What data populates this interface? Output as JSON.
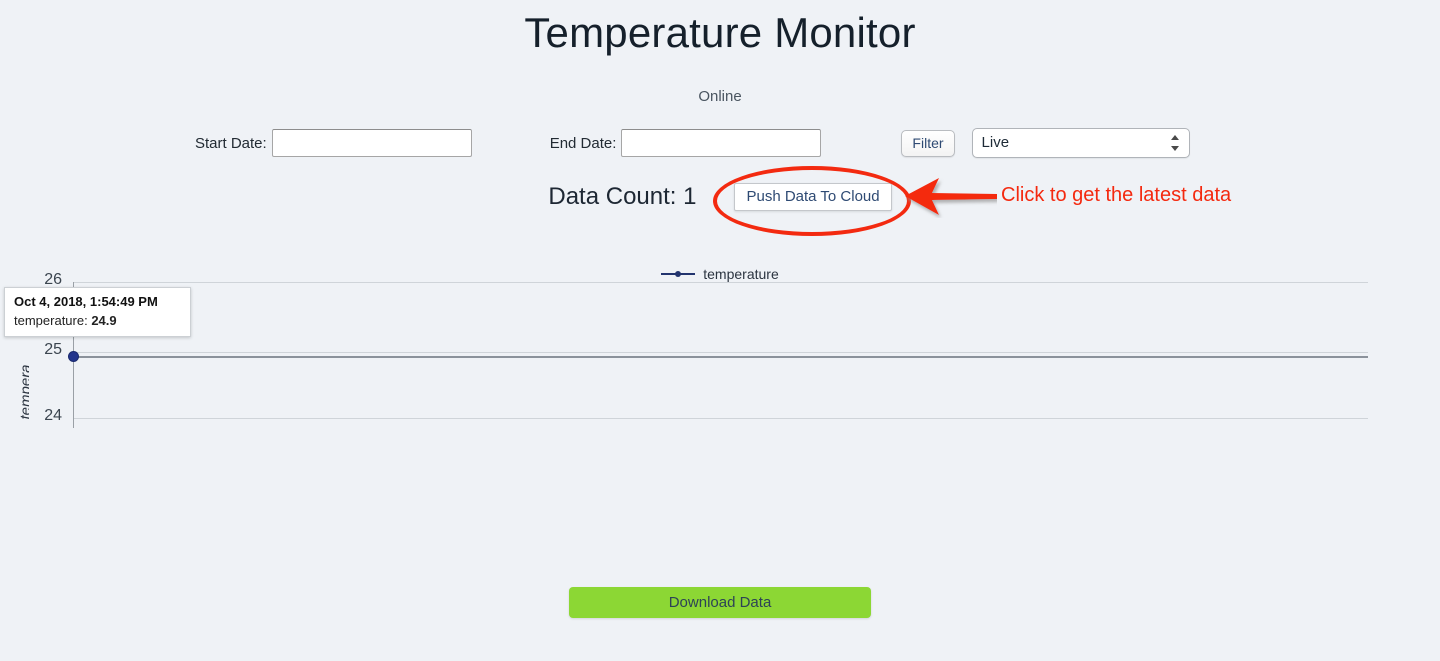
{
  "header": {
    "title": "Temperature Monitor",
    "status": "Online"
  },
  "filters": {
    "start_date_label": "Start Date:",
    "start_date_value": "",
    "start_date_placeholder": "",
    "end_date_label": "End Date:",
    "end_date_value": "",
    "end_date_placeholder": "",
    "filter_button_label": "Filter",
    "mode_select_value": "Live",
    "mode_select_options": [
      "Live"
    ]
  },
  "data_bar": {
    "count_label": "Data Count: 1",
    "push_button_label": "Push Data To Cloud"
  },
  "annotation": {
    "text": "Click to get the latest data",
    "color": "#f4290f"
  },
  "tooltip": {
    "timestamp": "Oct 4, 2018, 1:54:49 PM",
    "series_label": "temperature: ",
    "value": "24.9"
  },
  "footer": {
    "download_button_label": "Download Data",
    "download_button_color": "#8cd734"
  },
  "chart_data": {
    "type": "line",
    "title": "",
    "xlabel": "",
    "ylabel": "temperature",
    "ylabel_display": "tempera",
    "legend": [
      "temperature"
    ],
    "legend_position": "top-center",
    "grid": true,
    "ylim": [
      23.7,
      26.2
    ],
    "yticks": [
      26,
      25,
      24
    ],
    "ytick_labels": [
      "26",
      "25",
      "24"
    ],
    "series": [
      {
        "name": "temperature",
        "color": "#22346e",
        "x": [
          "Oct 4, 2018, 1:54:49 PM"
        ],
        "values": [
          24.9
        ]
      }
    ]
  }
}
